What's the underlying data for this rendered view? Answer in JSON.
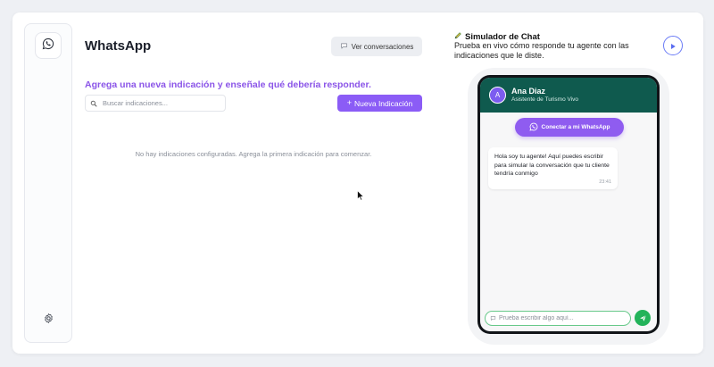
{
  "app": {
    "title": "WhatsApp",
    "view_conversations_label": "Ver conversaciones",
    "subtitle": "Agrega una nueva indicación y enseñale qué debería responder.",
    "search_placeholder": "Buscar indicaciones...",
    "new_button_label": "Nueva Indicación",
    "empty_message": "No hay indicaciones configuradas. Agrega la primera indicación para comenzar."
  },
  "sidebar": {
    "items": [
      {
        "icon": "whatsapp-icon"
      },
      {
        "icon": "gear-icon"
      }
    ]
  },
  "simulator": {
    "title": "Simulador de Chat",
    "description": "Prueba en vivo cómo responde tu agente con las indicaciones que le diste.",
    "contact": {
      "initial": "A",
      "name": "Ana Diaz",
      "subtitle": "Asistente de Turismo Vivo"
    },
    "connect_label": "Conectar a mi WhatsApp",
    "message": {
      "text": "Hola soy tu agente! Aquí puedes escribir para simular la conversación que tu cliente tendría conmigo",
      "time": "23:41"
    },
    "input_placeholder": "Prueba escribir algo aquí..."
  },
  "colors": {
    "accent_purple": "#8b5cf6",
    "whatsapp_header": "#0f5a4e",
    "send_green": "#23b35a",
    "input_border_green": "#68c98a"
  }
}
